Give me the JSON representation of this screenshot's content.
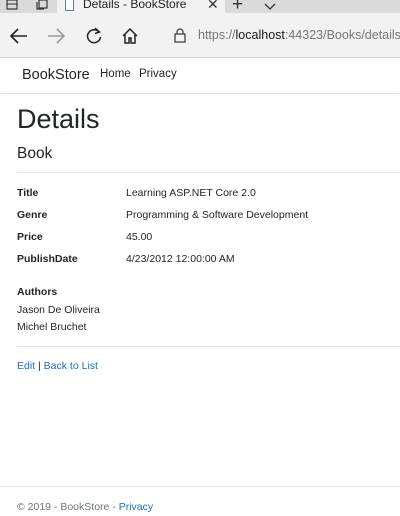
{
  "browser": {
    "tab_title": "Details - BookStore",
    "new_tab_symbol": "+",
    "close_symbol": "✕",
    "url": {
      "scheme": "https://",
      "host": "localhost",
      "rest": ":44323/Books/details"
    }
  },
  "site": {
    "brand": "BookStore",
    "nav": [
      "Home",
      "Privacy"
    ]
  },
  "page": {
    "title": "Details",
    "subtitle": "Book",
    "fields": [
      {
        "label": "Title",
        "value": "Learning ASP.NET Core 2.0"
      },
      {
        "label": "Genre",
        "value": "Programming & Software Development"
      },
      {
        "label": "Price",
        "value": "45.00"
      },
      {
        "label": "PublishDate",
        "value": "4/23/2012 12:00:00 AM"
      }
    ],
    "authors_label": "Authors",
    "authors": [
      "Jason De Oliveira",
      "Michel Bruchet"
    ],
    "edit_label": "Edit",
    "separator": "|",
    "back_label": "Back to List"
  },
  "footer": {
    "text": "© 2019 - BookStore - ",
    "privacy_label": "Privacy"
  }
}
